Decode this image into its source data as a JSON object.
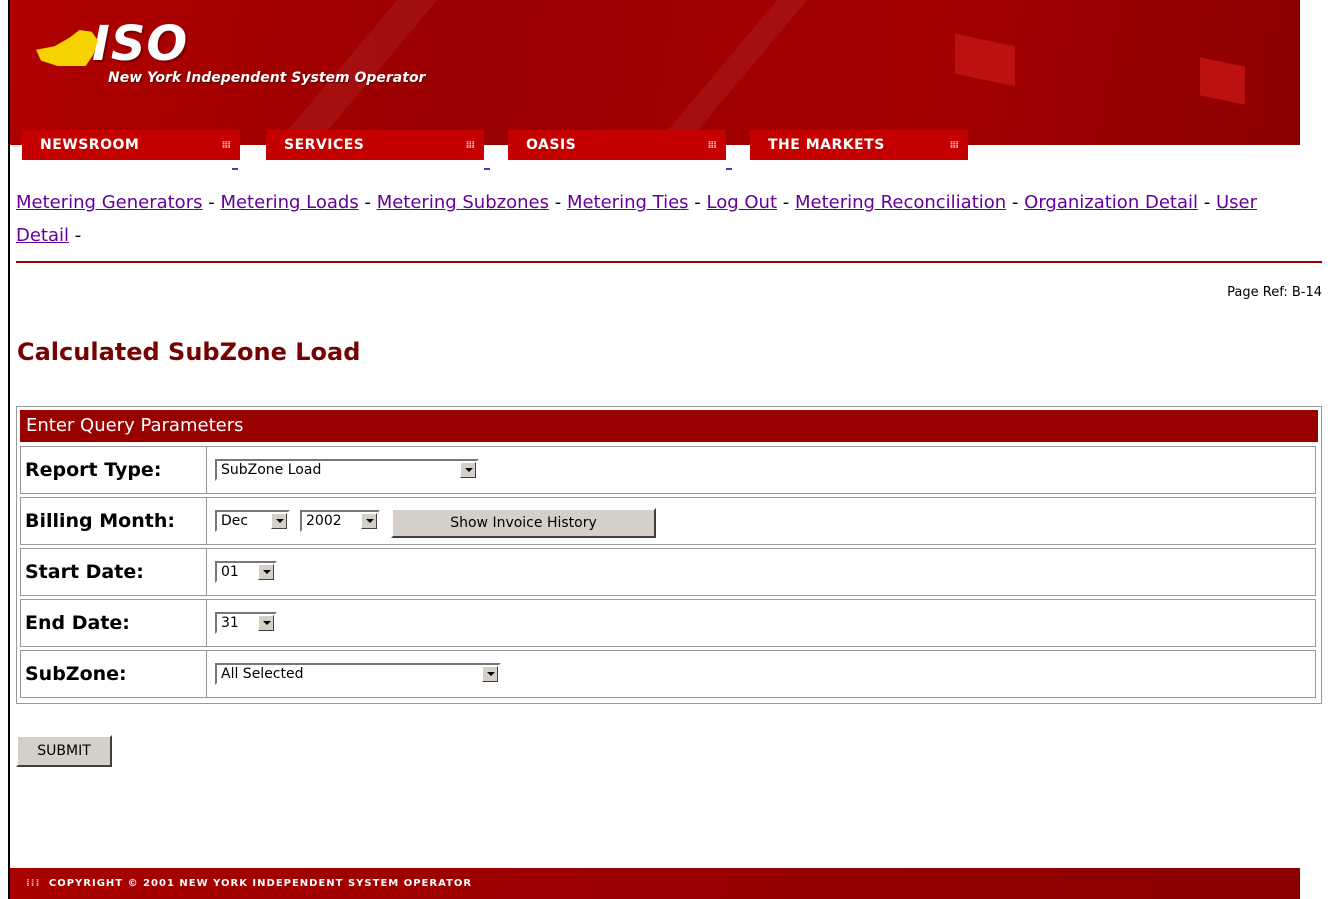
{
  "header": {
    "logo_text": "ISO",
    "subtitle": "New York Independent System Operator",
    "colors": {
      "brand": "#990000",
      "logo_yellow": "#f5d200"
    }
  },
  "nav": {
    "tabs": [
      {
        "label": "NEWSROOM"
      },
      {
        "label": "SERVICES"
      },
      {
        "label": "OASIS"
      },
      {
        "label": "THE MARKETS"
      }
    ]
  },
  "links": {
    "items": [
      "Metering Generators",
      "Metering Loads",
      "Metering Subzones",
      "Metering Ties",
      "Log Out",
      "Metering Reconciliation",
      "Organization Detail",
      "User Detail"
    ],
    "separator": "-"
  },
  "page": {
    "ref": "Page Ref: B-14",
    "title": "Calculated SubZone Load"
  },
  "form": {
    "heading": "Enter Query Parameters",
    "report_type": {
      "label": "Report Type:",
      "value": "SubZone Load"
    },
    "billing_month": {
      "label": "Billing Month:",
      "month": "Dec",
      "year": "2002",
      "history_button": "Show Invoice History"
    },
    "start_date": {
      "label": "Start Date:",
      "value": "01"
    },
    "end_date": {
      "label": "End Date:",
      "value": "31"
    },
    "subzone": {
      "label": "SubZone:",
      "value": "All Selected"
    },
    "submit": "SUBMIT"
  },
  "footer": {
    "copyright": "COPYRIGHT © 2001 NEW YORK INDEPENDENT SYSTEM OPERATOR"
  }
}
